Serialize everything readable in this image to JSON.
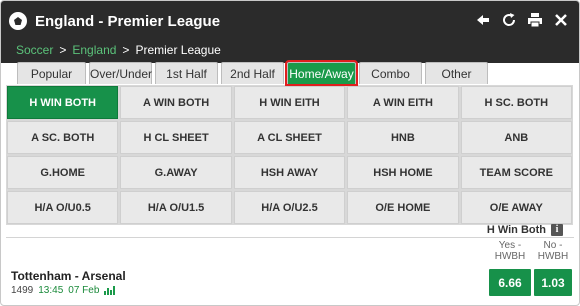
{
  "header": {
    "title": "England - Premier League",
    "toolbar": [
      "back-arrow-icon",
      "refresh-icon",
      "print-icon",
      "close-icon"
    ]
  },
  "breadcrumb": {
    "items": [
      "Soccer",
      "England",
      "Premier League"
    ],
    "separator": ">"
  },
  "tabs": [
    "Popular",
    "Over/Under",
    "1st Half",
    "2nd Half",
    "Home/Away",
    "Combo",
    "Other"
  ],
  "active_tab": "Home/Away",
  "markets": [
    "H WIN BOTH",
    "A WIN BOTH",
    "H WIN EITH",
    "A WIN EITH",
    "H SC. BOTH",
    "A SC. BOTH",
    "H CL SHEET",
    "A CL SHEET",
    "HNB",
    "ANB",
    "G.HOME",
    "G.AWAY",
    "HSH AWAY",
    "HSH HOME",
    "TEAM SCORE",
    "H/A O/U0.5",
    "H/A O/U1.5",
    "H/A O/U2.5",
    "O/E HOME",
    "O/E AWAY"
  ],
  "active_market": "H WIN BOTH",
  "market_panel": {
    "title": "H Win Both",
    "info_icon": "i",
    "columns": [
      {
        "line1": "Yes -",
        "line2": "HWBH"
      },
      {
        "line1": "No -",
        "line2": "HWBH"
      }
    ]
  },
  "event": {
    "name": "Tottenham - Arsenal",
    "id": "1499",
    "time": "13:45",
    "date": "07 Feb",
    "odds": [
      "6.66",
      "1.03"
    ]
  },
  "colors": {
    "header_bg": "#2b2b2b",
    "accent_green": "#17914a",
    "breadcrumb_link": "#5bc27a",
    "highlight_outline": "#e01e1e"
  }
}
